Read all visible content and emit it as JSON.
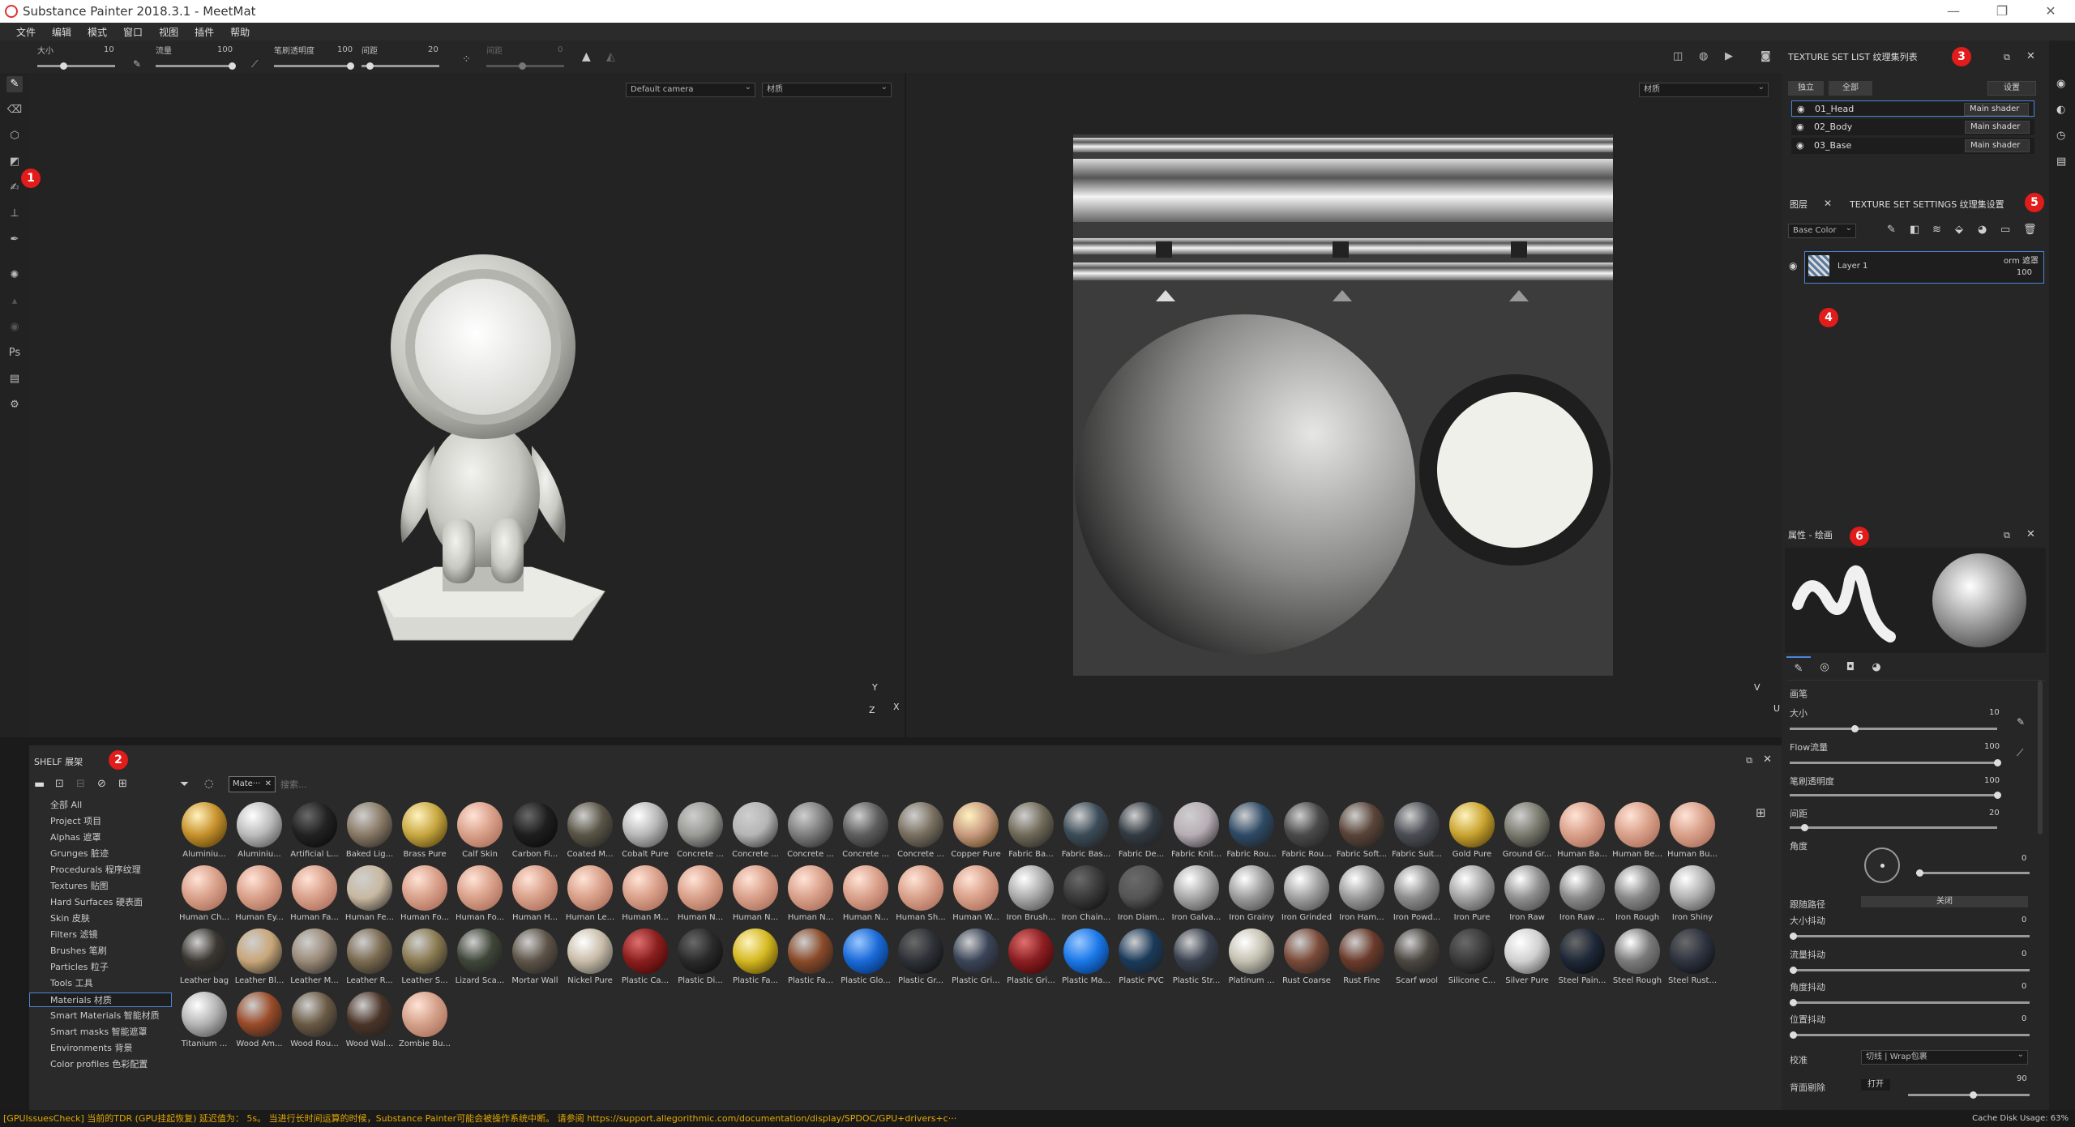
{
  "app": {
    "title": "Substance Painter 2018.3.1 - MeetMat"
  },
  "menu": [
    "文件",
    "编辑",
    "模式",
    "窗口",
    "视图",
    "插件",
    "帮助"
  ],
  "toolopts": {
    "size_label": "大小",
    "size_value": "10",
    "flow_label": "流量",
    "flow_value": "100",
    "opacity_label": "笔刷透明度",
    "opacity_value": "100",
    "spacing_label": "间距",
    "spacing_value": "20",
    "extra_label": "间距",
    "extra_value": "0"
  },
  "viewport": {
    "camera": "Default camera",
    "material": "材质",
    "material2": "材质"
  },
  "badges": [
    "1",
    "2",
    "3",
    "4",
    "5",
    "6"
  ],
  "shelf": {
    "title": "SHELF 展架",
    "filter_tag": "Mate···",
    "search_placeholder": "搜索...",
    "categories": [
      "全部 All",
      "Project 项目",
      "Alphas 遮罩",
      "Grunges 脏迹",
      "Procedurals 程序纹理",
      "Textures 贴图",
      "Hard Surfaces 硬表面",
      "Skin 皮肤",
      "Filters 滤镜",
      "Brushes 笔刷",
      "Particles 粒子",
      "Tools 工具",
      "Materials 材质",
      "Smart Materials 智能材质",
      "Smart masks 智能遮罩",
      "Environments 背景",
      "Color profiles 色彩配置"
    ],
    "selected": "Materials 材质",
    "materials": [
      {
        "n": "Aluminiu...",
        "c": "#c8922d",
        "t": "gold"
      },
      {
        "n": "Aluminiu...",
        "c": "#bbbbbb",
        "t": "metal"
      },
      {
        "n": "Artificial L...",
        "c": "#222222",
        "t": "dark"
      },
      {
        "n": "Baked Lig...",
        "c": "#8a7a66",
        "t": "mat"
      },
      {
        "n": "Brass Pure",
        "c": "#c9a842",
        "t": "gold"
      },
      {
        "n": "Calf Skin",
        "c": "#d9a08a",
        "t": "skin"
      },
      {
        "n": "Carbon Fi...",
        "c": "#1e1e1e",
        "t": "dark"
      },
      {
        "n": "Coated M...",
        "c": "#5a5546",
        "t": "mat"
      },
      {
        "n": "Cobalt Pure",
        "c": "#b8b8b8",
        "t": "metal"
      },
      {
        "n": "Concrete ...",
        "c": "#9a9a96",
        "t": "mat"
      },
      {
        "n": "Concrete ...",
        "c": "#b5b5b5",
        "t": "mat"
      },
      {
        "n": "Concrete ...",
        "c": "#7e7e7e",
        "t": "mat"
      },
      {
        "n": "Concrete ...",
        "c": "#5e5e5e",
        "t": "mat"
      },
      {
        "n": "Concrete ...",
        "c": "#7a7060",
        "t": "mat"
      },
      {
        "n": "Copper Pure",
        "c": "#c89a80",
        "t": "gold"
      },
      {
        "n": "Fabric Ba...",
        "c": "#706a58",
        "t": "mat"
      },
      {
        "n": "Fabric Bas...",
        "c": "#3b4c58",
        "t": "mat"
      },
      {
        "n": "Fabric De...",
        "c": "#323a42",
        "t": "mat"
      },
      {
        "n": "Fabric Knit...",
        "c": "#b8aeb5",
        "t": "mat"
      },
      {
        "n": "Fabric Rou...",
        "c": "#2e4a66",
        "t": "mat"
      },
      {
        "n": "Fabric Rou...",
        "c": "#4a4a4a",
        "t": "mat"
      },
      {
        "n": "Fabric Soft...",
        "c": "#5a4438",
        "t": "mat"
      },
      {
        "n": "Fabric Suit...",
        "c": "#4a4e54",
        "t": "mat"
      },
      {
        "n": "Gold Pure",
        "c": "#c9a430",
        "t": "gold"
      },
      {
        "n": "Ground Gr...",
        "c": "#7a7a6e",
        "t": "mat"
      },
      {
        "n": "Human Ba...",
        "c": "#d9a08a",
        "t": "skin"
      },
      {
        "n": "Human Be...",
        "c": "#d9a08a",
        "t": "skin"
      },
      {
        "n": "Human Bu...",
        "c": "#d9a08a",
        "t": "skin"
      },
      {
        "n": "Human Ch...",
        "c": "#d9a08a",
        "t": "skin"
      },
      {
        "n": "Human Ey...",
        "c": "#d9a08a",
        "t": "skin"
      },
      {
        "n": "Human Fa...",
        "c": "#d9a08a",
        "t": "skin"
      },
      {
        "n": "Human Fe...",
        "c": "#c8b8a0",
        "t": "mat"
      },
      {
        "n": "Human Fo...",
        "c": "#d9a08a",
        "t": "skin"
      },
      {
        "n": "Human Fo...",
        "c": "#d9a08a",
        "t": "skin"
      },
      {
        "n": "Human H...",
        "c": "#d9a08a",
        "t": "skin"
      },
      {
        "n": "Human Le...",
        "c": "#d9a08a",
        "t": "skin"
      },
      {
        "n": "Human M...",
        "c": "#d9a08a",
        "t": "skin"
      },
      {
        "n": "Human N...",
        "c": "#d9a08a",
        "t": "skin"
      },
      {
        "n": "Human N...",
        "c": "#d9a08a",
        "t": "skin"
      },
      {
        "n": "Human N...",
        "c": "#d9a08a",
        "t": "skin"
      },
      {
        "n": "Human N...",
        "c": "#d9a08a",
        "t": "skin"
      },
      {
        "n": "Human Sh...",
        "c": "#d9a08a",
        "t": "skin"
      },
      {
        "n": "Human W...",
        "c": "#d9a08a",
        "t": "skin"
      },
      {
        "n": "Iron Brush...",
        "c": "#aaaaaa",
        "t": "metal"
      },
      {
        "n": "Iron Chain...",
        "c": "#3a3a3a",
        "t": "dark"
      },
      {
        "n": "Iron Diam...",
        "c": "#555555",
        "t": "dark"
      },
      {
        "n": "Iron Galva...",
        "c": "#a8a8a8",
        "t": "metal"
      },
      {
        "n": "Iron Grainy",
        "c": "#9c9c9c",
        "t": "metal"
      },
      {
        "n": "Iron Grinded",
        "c": "#a0a0a0",
        "t": "metal"
      },
      {
        "n": "Iron Ham...",
        "c": "#9a9a9a",
        "t": "metal"
      },
      {
        "n": "Iron Powd...",
        "c": "#8c8c8c",
        "t": "metal"
      },
      {
        "n": "Iron Pure",
        "c": "#a4a4a4",
        "t": "metal"
      },
      {
        "n": "Iron Raw",
        "c": "#909090",
        "t": "metal"
      },
      {
        "n": "Iron Raw ...",
        "c": "#8a8a8a",
        "t": "metal"
      },
      {
        "n": "Iron Rough",
        "c": "#888888",
        "t": "metal"
      },
      {
        "n": "Iron Shiny",
        "c": "#b0b0b0",
        "t": "metal"
      },
      {
        "n": "Leather bag",
        "c": "#3a3630",
        "t": "mat"
      },
      {
        "n": "Leather Bl...",
        "c": "#c8a678",
        "t": "mat"
      },
      {
        "n": "Leather M...",
        "c": "#9a8a78",
        "t": "mat"
      },
      {
        "n": "Leather R...",
        "c": "#7a6a50",
        "t": "mat"
      },
      {
        "n": "Leather S...",
        "c": "#8a7a50",
        "t": "mat"
      },
      {
        "n": "Lizard Sca...",
        "c": "#3e4638",
        "t": "mat"
      },
      {
        "n": "Mortar Wall",
        "c": "#5e5448",
        "t": "mat"
      },
      {
        "n": "Nickel Pure",
        "c": "#c8bca8",
        "t": "metal"
      },
      {
        "n": "Plastic Ca...",
        "c": "#8a1e1e",
        "t": "red"
      },
      {
        "n": "Plastic Di...",
        "c": "#2a2a2a",
        "t": "dark"
      },
      {
        "n": "Plastic Fa...",
        "c": "#d4b820",
        "t": "gold"
      },
      {
        "n": "Plastic Fa...",
        "c": "#8a4a28",
        "t": "mat"
      },
      {
        "n": "Plastic Glo...",
        "c": "#1a6ad8",
        "t": "blue"
      },
      {
        "n": "Plastic Gr...",
        "c": "#2e3238",
        "t": "dark"
      },
      {
        "n": "Plastic Gri...",
        "c": "#3a4458",
        "t": "mat"
      },
      {
        "n": "Plastic Gri...",
        "c": "#8a1e22",
        "t": "red"
      },
      {
        "n": "Plastic Ma...",
        "c": "#1a78e8",
        "t": "blue"
      },
      {
        "n": "Plastic PVC",
        "c": "#1a3a5a",
        "t": "mat"
      },
      {
        "n": "Plastic Str...",
        "c": "#3a4250",
        "t": "mat"
      },
      {
        "n": "Platinum ...",
        "c": "#c4c0b0",
        "t": "metal"
      },
      {
        "n": "Rust Coarse",
        "c": "#7a4a38",
        "t": "mat"
      },
      {
        "n": "Rust Fine",
        "c": "#6a3a2a",
        "t": "mat"
      },
      {
        "n": "Scarf wool",
        "c": "#4a4640",
        "t": "mat"
      },
      {
        "n": "Silicone C...",
        "c": "#3a3a3a",
        "t": "dark"
      },
      {
        "n": "Silver Pure",
        "c": "#d0d0d0",
        "t": "metal"
      },
      {
        "n": "Steel Pain...",
        "c": "#1e2838",
        "t": "dark"
      },
      {
        "n": "Steel Rough",
        "c": "#7a7a7a",
        "t": "metal"
      },
      {
        "n": "Steel Rust...",
        "c": "#2e3440",
        "t": "dark"
      },
      {
        "n": "Titanium ...",
        "c": "#b4b4b4",
        "t": "metal"
      },
      {
        "n": "Wood Am...",
        "c": "#9a4a28",
        "t": "mat"
      },
      {
        "n": "Wood Rou...",
        "c": "#6a5a44",
        "t": "mat"
      },
      {
        "n": "Wood Wal...",
        "c": "#4a3428",
        "t": "mat"
      },
      {
        "n": "Zombie Bu...",
        "c": "#d4a08a",
        "t": "skin"
      }
    ]
  },
  "textureset": {
    "title": "TEXTURE SET LIST 纹理集列表",
    "tab_solo": "独立",
    "tab_all": "全部",
    "settings": "设置",
    "rows": [
      {
        "name": "01_Head",
        "shader": "Main shader"
      },
      {
        "name": "02_Body",
        "shader": "Main shader"
      },
      {
        "name": "03_Base",
        "shader": "Main shader"
      }
    ]
  },
  "layers": {
    "tab_layers": "图层",
    "tab_settings": "TEXTURE SET SETTINGS 纹理集设置",
    "channel": "Base Color",
    "layer_name": "Layer 1",
    "blend": "orm 遮罩",
    "opacity": "100"
  },
  "props": {
    "title": "属性 - 绘画",
    "section": "画笔",
    "size_label": "大小",
    "size_value": "10",
    "flow_label": "Flow流量",
    "flow_value": "100",
    "opacity_label": "笔刷透明度",
    "opacity_value": "100",
    "spacing_label": "间距",
    "spacing_value": "20",
    "angle_label": "角度",
    "angle_value": "0",
    "follow_label": "跟随路径",
    "follow_value": "关闭",
    "size_jit_label": "大小抖动",
    "size_jit_value": "0",
    "flow_jit_label": "流量抖动",
    "flow_jit_value": "0",
    "angle_jit_label": "角度抖动",
    "angle_jit_value": "0",
    "pos_jit_label": "位置抖动",
    "pos_jit_value": "0",
    "align_label": "校准",
    "align_value": "切线 | Wrap包裹",
    "bg_label": "背面剔除",
    "bg_toggle": "打开",
    "bg_value": "90"
  },
  "status": {
    "message": "[GPUIssuesCheck] 当前的TDR (GPU挂起恢复) 延迟值为： 5s。 当进行长时间运算的时候，Substance Painter可能会被操作系统中断。 请参阅 https://support.allegorithmic.com/documentation/display/SPDOC/GPU+drivers+c···",
    "cache": "Cache Disk Usage:  63%"
  },
  "colors": {
    "accent": "#4a86d9",
    "badge": "#e21b1b",
    "status": "#e0a800"
  }
}
